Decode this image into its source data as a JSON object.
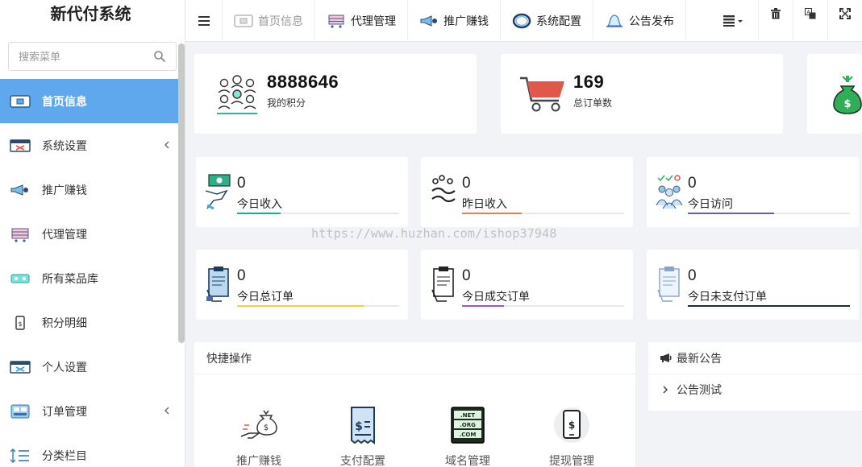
{
  "brand": "新代付系统",
  "search": {
    "placeholder": "搜索菜单"
  },
  "sidebar": {
    "items": [
      {
        "label": "首页信息",
        "icon": "dashboard-icon",
        "active": true
      },
      {
        "label": "系统设置",
        "icon": "system-settings-icon",
        "has_children": true
      },
      {
        "label": "推广赚钱",
        "icon": "megaphone-icon"
      },
      {
        "label": "代理管理",
        "icon": "agent-cart-icon"
      },
      {
        "label": "所有菜品库",
        "icon": "dish-library-icon"
      },
      {
        "label": "积分明细",
        "icon": "points-detail-icon"
      },
      {
        "label": "个人设置",
        "icon": "personal-settings-icon"
      },
      {
        "label": "订单管理",
        "icon": "order-management-icon",
        "has_children": true
      },
      {
        "label": "分类栏目",
        "icon": "category-icon"
      }
    ]
  },
  "topbar": {
    "nav": [
      {
        "label": "首页信息",
        "icon": "dashboard-icon",
        "dim": true
      },
      {
        "label": "代理管理",
        "icon": "agent-cart-icon"
      },
      {
        "label": "推广赚钱",
        "icon": "megaphone-icon"
      },
      {
        "label": "系统配置",
        "icon": "ring-icon"
      },
      {
        "label": "公告发布",
        "icon": "bell-icon"
      }
    ],
    "right_icons": [
      "list-menu-icon",
      "trash-icon",
      "translate-icon",
      "fullscreen-icon"
    ]
  },
  "big_cards": [
    {
      "value": "8888646",
      "label": "我的积分",
      "icon": "people-network-icon"
    },
    {
      "value": "169",
      "label": "总订单数",
      "icon": "shopping-cart-icon"
    },
    {
      "value": "",
      "label": "",
      "icon": "money-bag-icon"
    }
  ],
  "stat_cards": [
    {
      "value": "0",
      "label": "今日收入",
      "icon": "cash-hand-icon",
      "bar_color": "#1aae8a",
      "progress": 0.27
    },
    {
      "value": "0",
      "label": "昨日收入",
      "icon": "handshake-icon",
      "bar_color": "#f07a4f",
      "progress": 0.37
    },
    {
      "value": "0",
      "label": "今日访问",
      "icon": "visitors-icon",
      "bar_color": "#6a5ab8",
      "progress": 0.53
    },
    {
      "value": "0",
      "label": "今日总订单",
      "icon": "order-clipboard-icon",
      "bar_color": "#f4d03f",
      "progress": 0.78
    },
    {
      "value": "0",
      "label": "今日成交订单",
      "icon": "order-clipboard-icon",
      "bar_color": "#9b59d0",
      "progress": 0.26
    },
    {
      "value": "0",
      "label": "今日未支付订单",
      "icon": "order-clipboard-icon",
      "bar_color": "#1f2a3a",
      "progress": 1.0
    }
  ],
  "quick_ops": {
    "title": "快捷操作",
    "items": [
      {
        "label": "推广赚钱",
        "icon": "money-hand-icon"
      },
      {
        "label": "支付配置",
        "icon": "receipt-icon"
      },
      {
        "label": "域名管理",
        "icon": "domain-icon"
      },
      {
        "label": "提现管理",
        "icon": "phone-withdraw-icon"
      }
    ]
  },
  "notice": {
    "title": "最新公告",
    "items": [
      "公告测试"
    ]
  },
  "watermark": "https://www.huzhan.com/ishop37948",
  "colors": {
    "accent": "#5fa8ee",
    "background": "#f2f3f6"
  }
}
